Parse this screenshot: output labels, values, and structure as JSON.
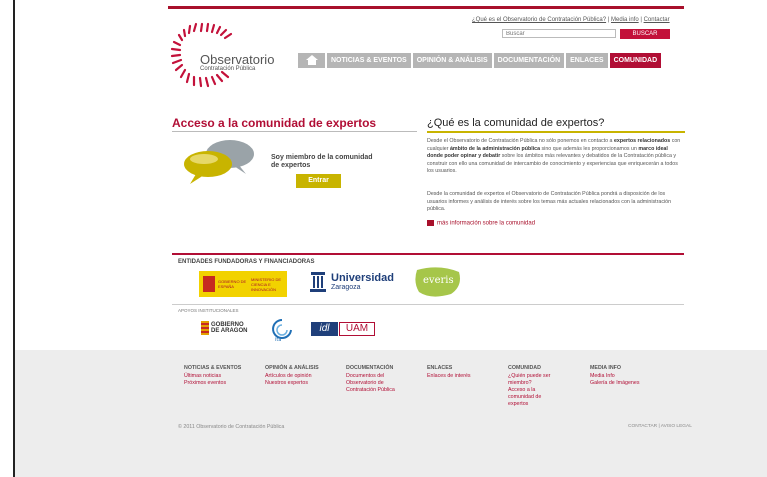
{
  "utility": {
    "link_about": "¿Qué es el Observatorio de Contratación Pública?",
    "sep1": " | ",
    "link_media": "Media info",
    "sep2": " | ",
    "link_contact": "Contactar"
  },
  "search": {
    "placeholder": "Buscar",
    "button": "BUSCAR"
  },
  "logo": {
    "title": "Observatorio",
    "subtitle": "Contratación Pública"
  },
  "nav": {
    "home_icon": "home-icon",
    "items": [
      {
        "label": "NOTICIAS & EVENTOS"
      },
      {
        "label": "OPINIÓN & ANÁLISIS"
      },
      {
        "label": "DOCUMENTACIÓN"
      },
      {
        "label": "ENLACES"
      },
      {
        "label": "COMUNIDAD"
      }
    ],
    "active_color": "#b10e35",
    "inactive_color": "#b5b5b5"
  },
  "left": {
    "title": "Acceso a la comunidad de expertos",
    "member_text": "Soy miembro de la comunidad de expertos",
    "enter_button": "Entrar"
  },
  "right": {
    "title": "¿Qué es la comunidad de expertos?",
    "p1_a": "Desde el Observatorio de Contratación Pública no sólo ponemos en contacto a ",
    "p1_b": "expertos relacionados",
    "p1_c": " con cualquier ",
    "p1_d": "ámbito de la administración pública",
    "p1_e": " sino que además les proporcionamos un ",
    "p1_f": "marco ideal donde poder opinar y debatir",
    "p1_g": " sobre los ámbitos más relevantes y debatidos de la Contratación pública y construir con ello una comunidad de intercambio de conocimiento y experiencias que enriquecerán a todos los usuarios.",
    "p2": "Desde la comunidad de expertos el Observatorio de Contratación Pública pondrá a disposición de los usuarios informes y análisis de interés sobre los temas más actuales relacionados con la administración pública.",
    "more_link": "más información sobre la comunidad"
  },
  "entities": {
    "label": "ENTIDADES FUNDADORAS Y FINANCIADORAS",
    "gob_text": "GOBIERNO DE ESPAÑA",
    "gob_ministry": "MINISTERIO DE CIENCIA E INNOVACIÓN",
    "unizar_name": "Universidad",
    "unizar_city": "Zaragoza",
    "everis": "everis"
  },
  "support": {
    "label": "APOYOS INSTITUCIONALES",
    "aragon_line1": "GOBIERNO",
    "aragon_line2": "DE ARAGON",
    "ita": "ita",
    "idl": "idl",
    "uam": "UAM"
  },
  "footer": {
    "columns": [
      {
        "head": "NOTICIAS & EVENTOS",
        "links": [
          "Últimas noticias",
          "Próximos eventos"
        ]
      },
      {
        "head": "OPINIÓN & ANÁLISIS",
        "links": [
          "Artículos de opinión",
          "Nuestros expertos"
        ]
      },
      {
        "head": "DOCUMENTACIÓN",
        "links": [
          "Documentos del Observatorio de Contratación Pública"
        ]
      },
      {
        "head": "ENLACES",
        "links": [
          "Enlaces de interés"
        ]
      },
      {
        "head": "COMUNIDAD",
        "links": [
          "¿Quién puede ser miembro?",
          "Acceso a la comunidad de expertos"
        ]
      },
      {
        "head": "MEDIA INFO",
        "links": [
          "Media Info",
          "Galería de Imágenes"
        ]
      }
    ],
    "copyright": "© 2011 Observatorio de Contratación Pública",
    "legal": "CONTACTAR | AVISO LEGAL"
  }
}
